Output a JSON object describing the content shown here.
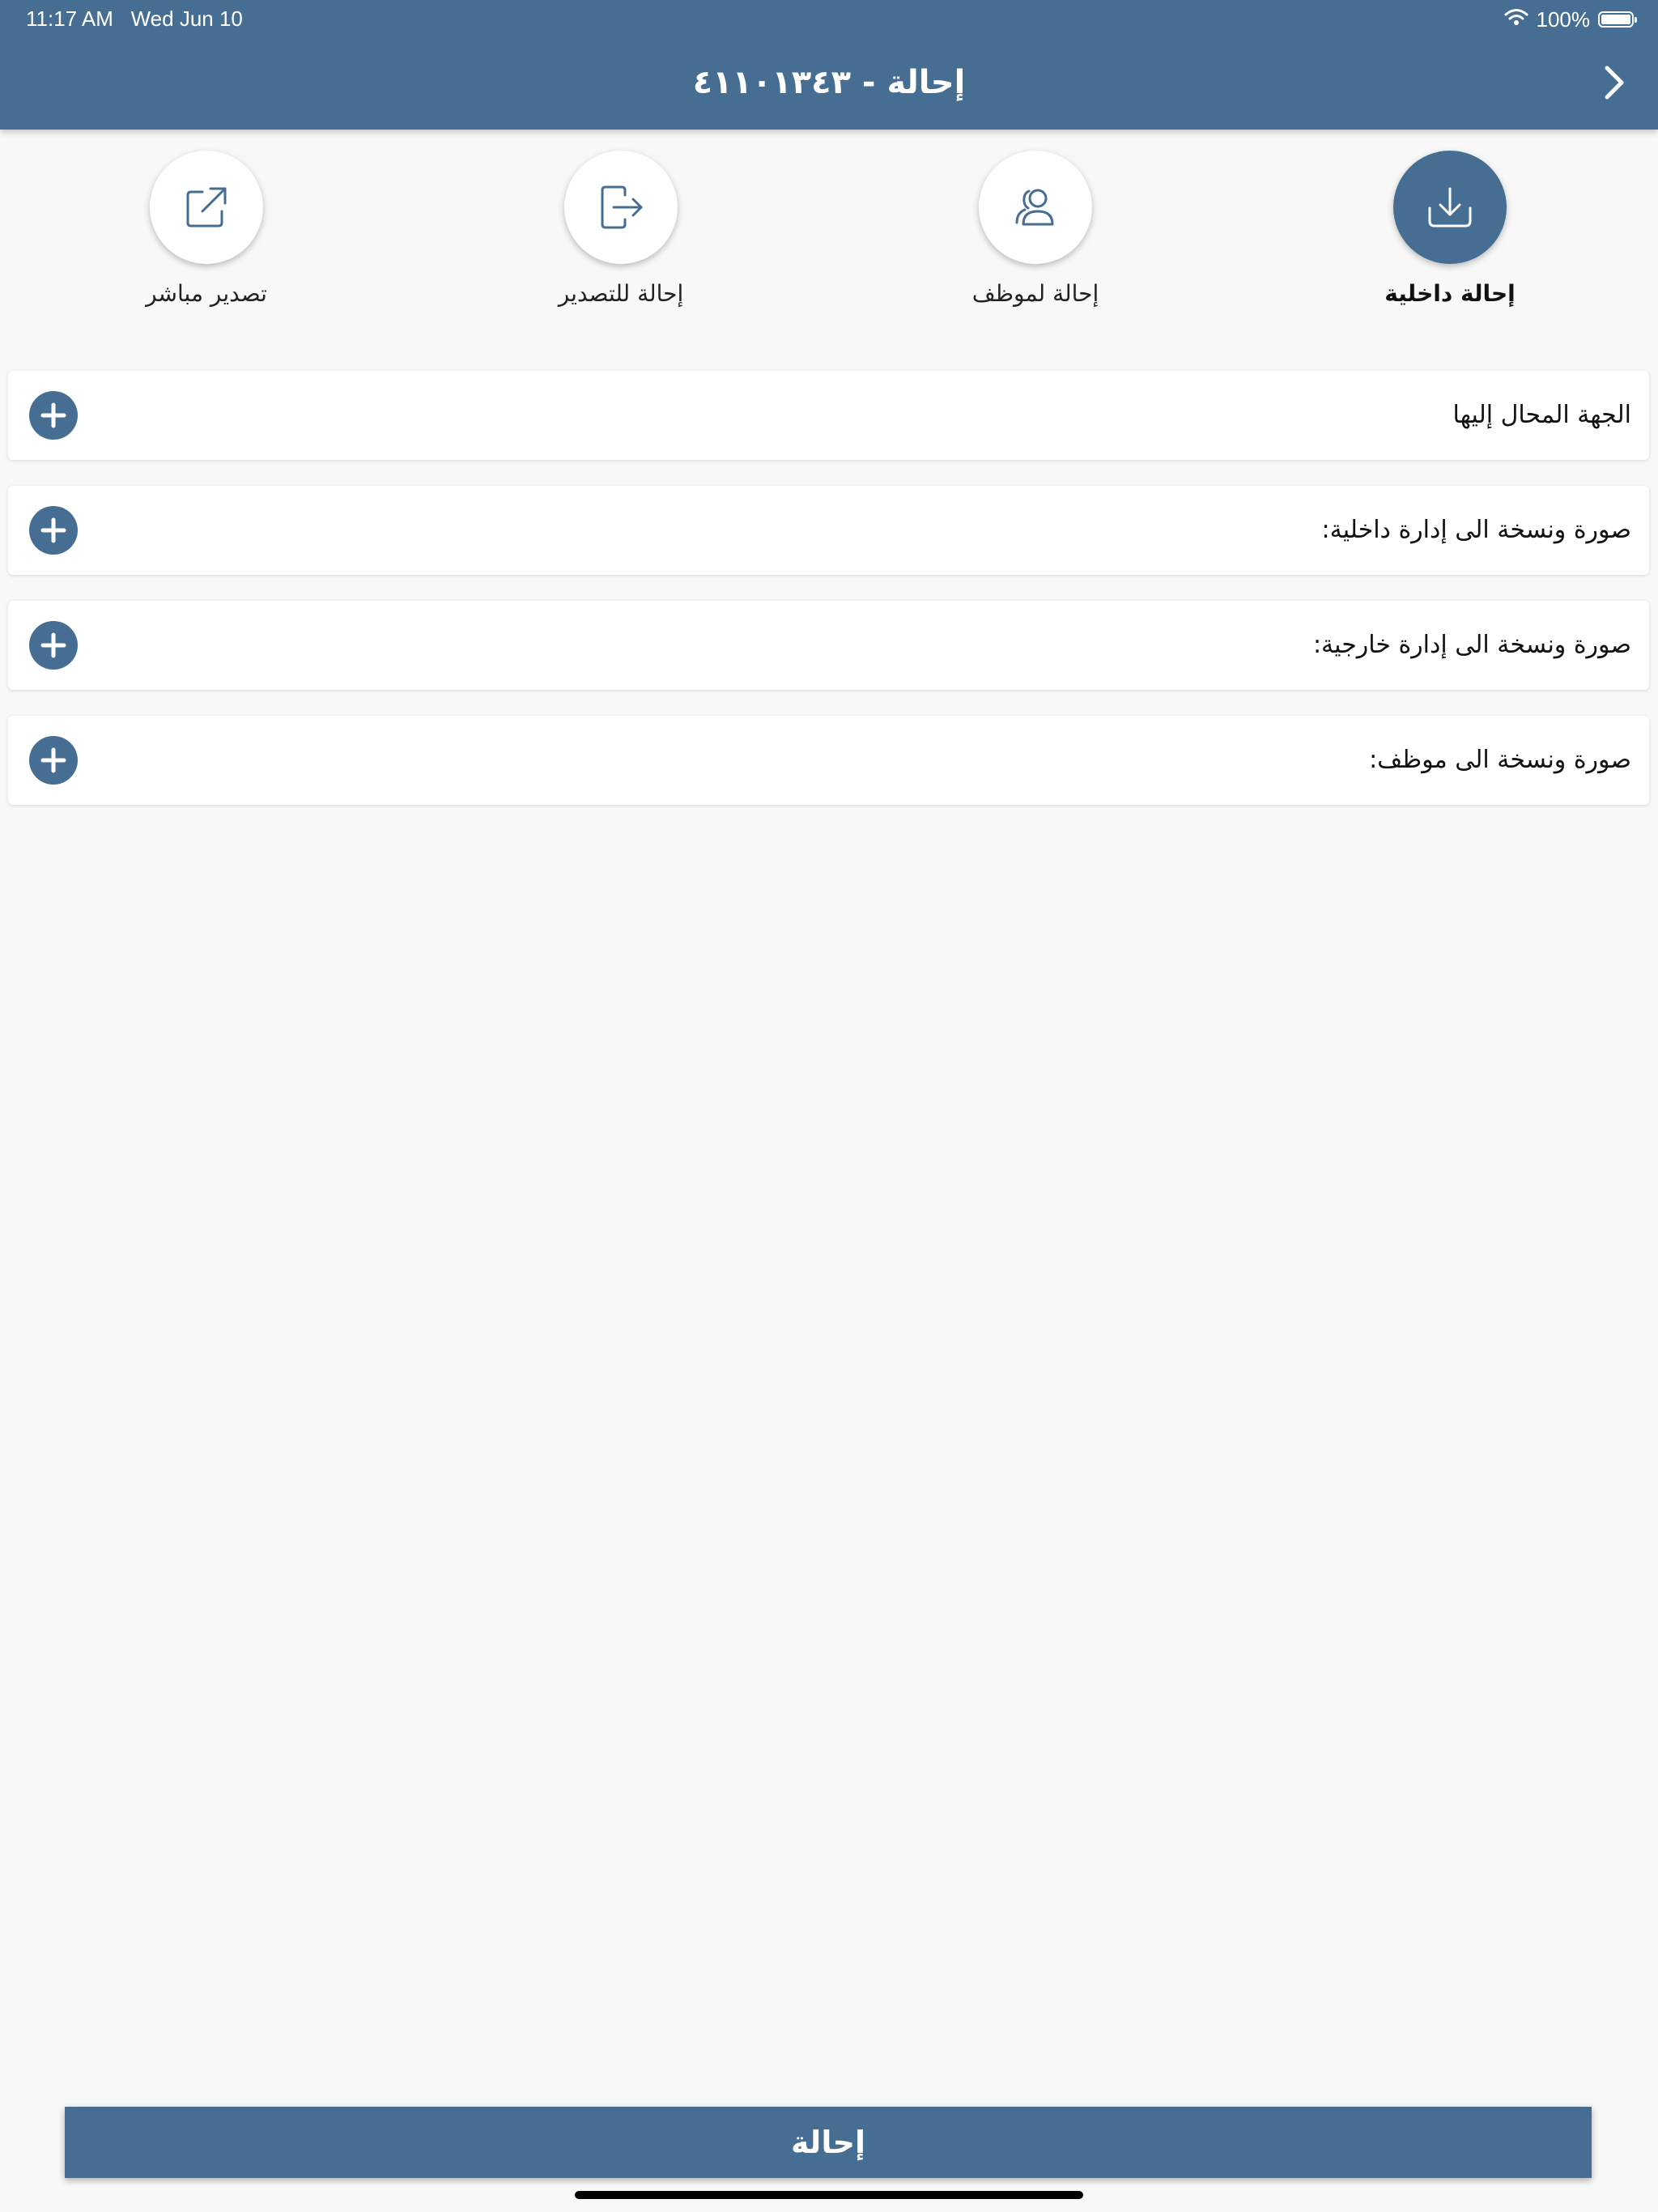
{
  "status_bar": {
    "time": "11:17 AM",
    "date": "Wed Jun 10",
    "battery": "100%"
  },
  "header": {
    "title": "إحالة - ٤١١٠١٣٤٣",
    "back_icon": "chevron-right-icon"
  },
  "options": [
    {
      "label": "إحالة داخلية",
      "icon": "download-tray-icon",
      "active": true
    },
    {
      "label": "إحالة لموظف",
      "icon": "user-icon",
      "active": false
    },
    {
      "label": "إحالة للتصدير",
      "icon": "logout-arrow-icon",
      "active": false
    },
    {
      "label": "تصدير مباشر",
      "icon": "external-link-icon",
      "active": false
    }
  ],
  "rows": [
    {
      "label": "الجهة المحال إليها"
    },
    {
      "label": "صورة ونسخة الى إدارة داخلية:"
    },
    {
      "label": "صورة ونسخة الى إدارة خارجية:"
    },
    {
      "label": "صورة ونسخة الى موظف:"
    }
  ],
  "submit_label": "إحالة",
  "colors": {
    "primary": "#466e93",
    "background": "#f8f8f8"
  }
}
